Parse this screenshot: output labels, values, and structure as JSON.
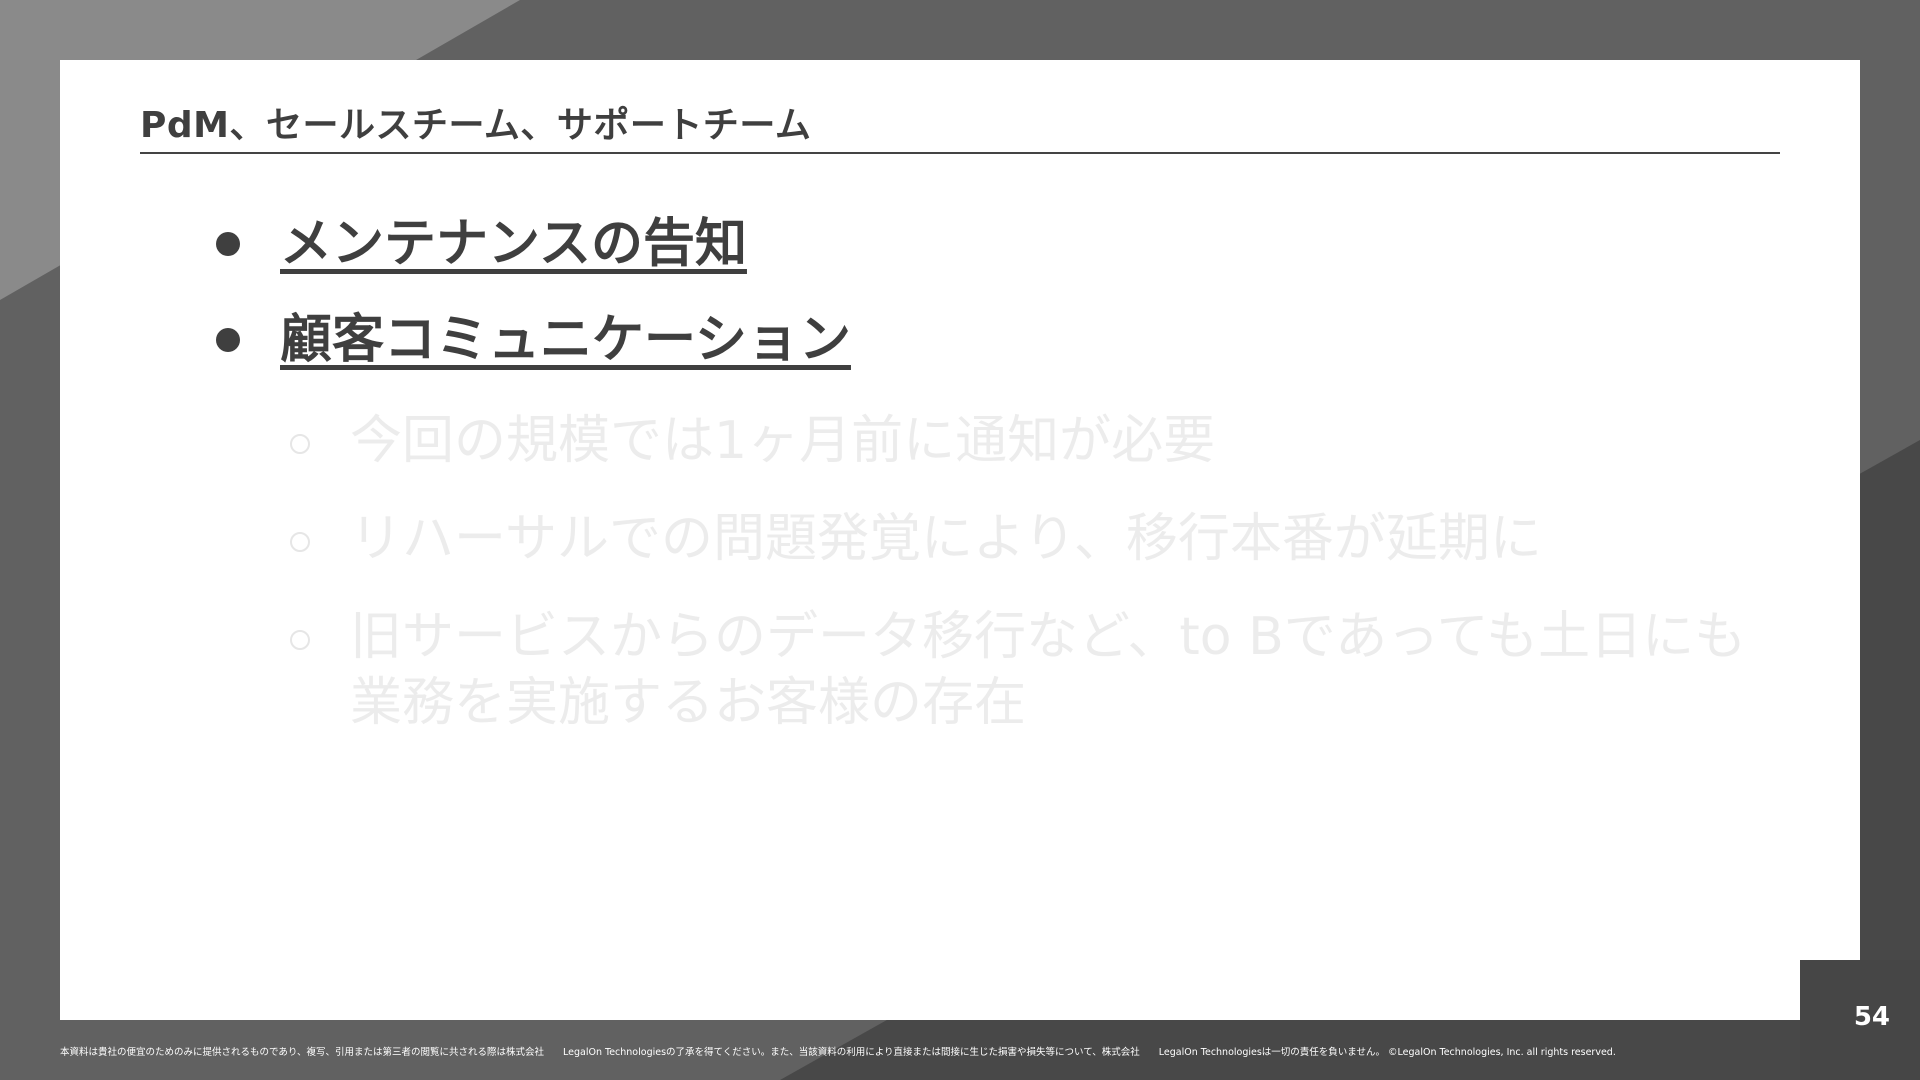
{
  "slide": {
    "title": "PdM、セールスチーム、サポートチーム",
    "bullets": [
      {
        "text": "メンテナンスの告知"
      },
      {
        "text": "顧客コミュニケーション"
      }
    ],
    "sub_bullets": [
      {
        "text": "今回の規模では1ヶ月前に通知が必要"
      },
      {
        "text": "リハーサルでの問題発覚により、移行本番が延期に"
      },
      {
        "text": "旧サービスからのデータ移行など、to Bであっても土日にも業務を実施するお客様の存在"
      }
    ],
    "page_number": "54",
    "footer": "本資料は貴社の便宜のためのみに提供されるものであり、複写、引用または第三者の閲覧に共される際は株式会社　　LegalOn Technologiesの了承を得てください。また、当該資料の利用により直接または間接に生じた損害や損失等について、株式会社　　LegalOn Technologiesは一切の責任を負いません。 ©LegalOn Technologies, Inc. all rights reserved."
  },
  "colors": {
    "background": "#616161",
    "slide": "#ffffff",
    "text_dark": "#3f3f3f",
    "text_faded": "#ececec"
  }
}
